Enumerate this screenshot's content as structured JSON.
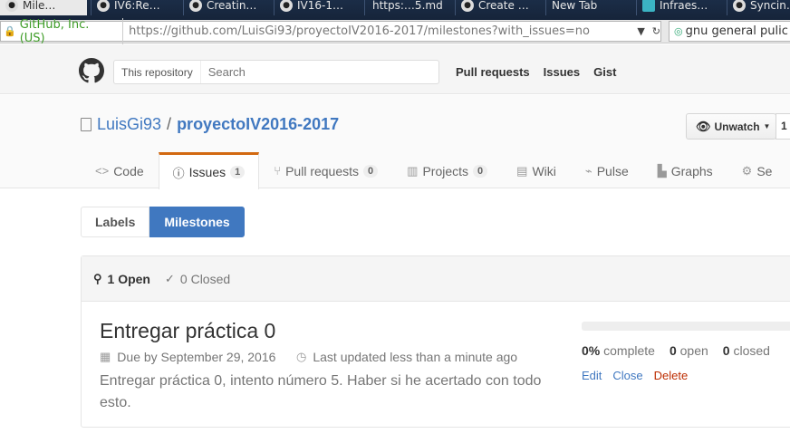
{
  "browser": {
    "tabs": [
      {
        "label": "Mile…",
        "icon": "github-icon"
      },
      {
        "label": "IV6:Re…",
        "icon": "github-icon"
      },
      {
        "label": "Creatin…",
        "icon": "github-icon"
      },
      {
        "label": "IV16-1…",
        "icon": "github-icon"
      },
      {
        "label": "https:…5.md",
        "icon": "page-icon"
      },
      {
        "label": "Create …",
        "icon": "github-icon"
      },
      {
        "label": "New Tab",
        "icon": "page-icon"
      },
      {
        "label": "Infraes…",
        "icon": "page-icon"
      },
      {
        "label": "Syncin…",
        "icon": "github-icon"
      }
    ],
    "site_identity": "GitHub, Inc. (US)",
    "url": "https://github.com/LuisGi93/proyectoIV2016-2017/milestones?with_issues=no",
    "search_value": "gnu general pulic"
  },
  "header": {
    "scope_label": "This repository",
    "search_placeholder": "Search",
    "nav": [
      "Pull requests",
      "Issues",
      "Gist"
    ]
  },
  "repo": {
    "owner": "LuisGi93",
    "separator": "/",
    "name": "proyectoIV2016-2017",
    "watch_label": "Unwatch",
    "watch_count": "1",
    "tabs": [
      {
        "label": "Code",
        "icon": "code-icon",
        "count": null
      },
      {
        "label": "Issues",
        "icon": "issue-icon",
        "count": "1"
      },
      {
        "label": "Pull requests",
        "icon": "pull-request-icon",
        "count": "0"
      },
      {
        "label": "Projects",
        "icon": "project-icon",
        "count": "0"
      },
      {
        "label": "Wiki",
        "icon": "book-icon",
        "count": null
      },
      {
        "label": "Pulse",
        "icon": "pulse-icon",
        "count": null
      },
      {
        "label": "Graphs",
        "icon": "graph-icon",
        "count": null
      },
      {
        "label": "Se",
        "icon": "gear-icon",
        "count": null
      }
    ]
  },
  "subnav": {
    "labels": "Labels",
    "milestones": "Milestones"
  },
  "states": {
    "open": "1 Open",
    "closed": "0 Closed"
  },
  "milestone": {
    "title": "Entregar práctica 0",
    "due": "Due by September 29, 2016",
    "updated": "Last updated less than a minute ago",
    "description": "Entregar práctica 0, intento número 5. Haber si he acertado con todo esto.",
    "progress": 0,
    "percent": "0%",
    "percent_label": "complete",
    "open_count": "0",
    "open_label": "open",
    "closed_count": "0",
    "closed_label": "closed",
    "actions": {
      "edit": "Edit",
      "close": "Close",
      "delete": "Delete"
    }
  },
  "colors": {
    "accent": "#4078c0",
    "tab_highlight": "#d26911",
    "delete": "#bd2c00"
  }
}
